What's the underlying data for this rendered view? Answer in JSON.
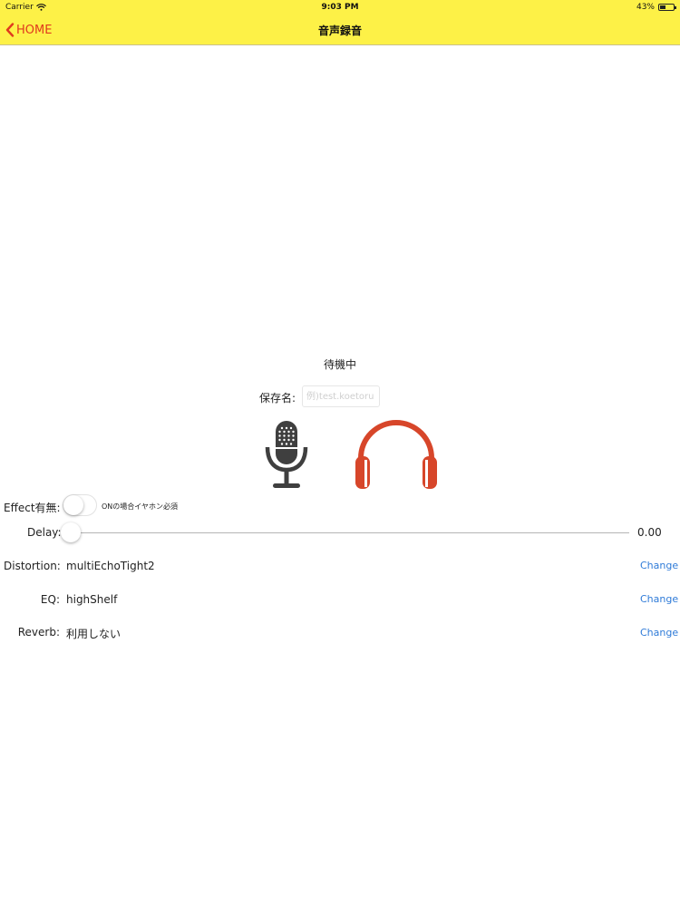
{
  "status_bar": {
    "carrier": "Carrier",
    "time": "9:03 PM",
    "battery": "43%",
    "battery_level": 0.43
  },
  "nav": {
    "back_label": "HOME",
    "title": "音声録音"
  },
  "recorder": {
    "status": "待機中",
    "save_label": "保存名:",
    "save_placeholder": "例)test.koetoru"
  },
  "effect": {
    "label": "Effect有無:",
    "note": "ONの場合イヤホン必須",
    "enabled": false
  },
  "delay": {
    "label": "Delay:",
    "value": "0.00"
  },
  "settings": [
    {
      "label": "Distortion:",
      "value": "multiEchoTight2",
      "action": "Change"
    },
    {
      "label": "EQ:",
      "value": "highShelf",
      "action": "Change"
    },
    {
      "label": "Reverb:",
      "value": "利用しない",
      "action": "Change"
    }
  ],
  "colors": {
    "header_bg": "#fdf147",
    "accent": "#e03a1e",
    "link": "#2f7bd8",
    "headphones": "#d7462a",
    "mic": "#3f3f3f"
  }
}
